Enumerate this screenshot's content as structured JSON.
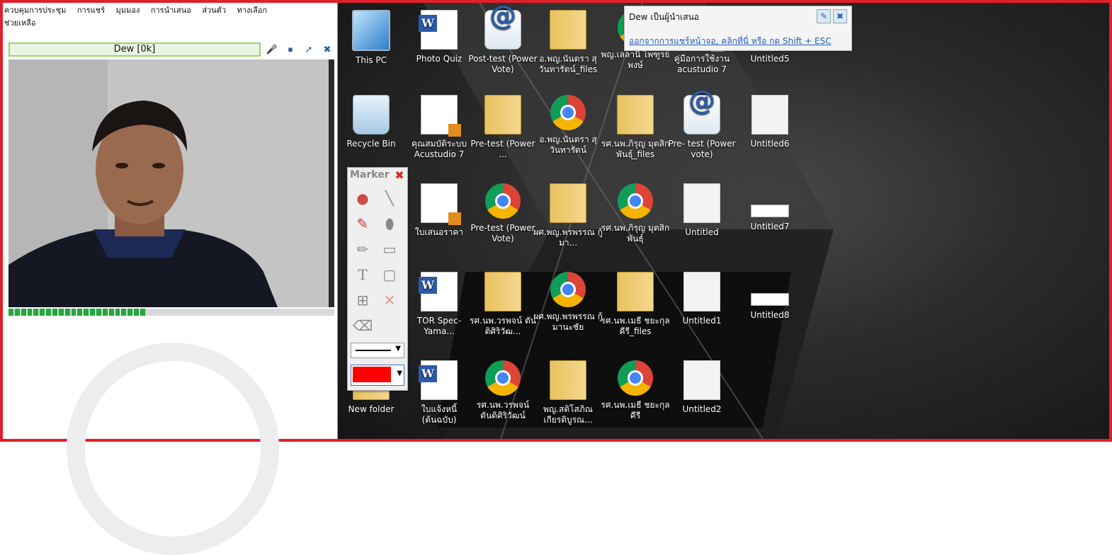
{
  "menu": {
    "items": [
      "ควบคุมการประชุม",
      "การแชร์",
      "มุมมอง",
      "การนำเสนอ",
      "ส่วนตัว",
      "ทางเลือก"
    ],
    "second_line": "ช่วยเหลือ"
  },
  "participant": {
    "name_label": "Dew [0k]",
    "level_fraction": 0.42
  },
  "presenter_panel": {
    "title": "Dew เป็นผู้นำเสนอ",
    "exit_link": "ออกจากการแชร์หน้าจอ, คลิกที่นี่ หรือ กด Shift + ESC"
  },
  "marker_palette": {
    "title": "Marker",
    "selected_color": "#ff0000"
  },
  "desktop_icons": [
    {
      "label": "This PC",
      "icon": "this-pc"
    },
    {
      "label": "Photo Quiz",
      "icon": "word-doc"
    },
    {
      "label": "Post-test (Power Vote)",
      "icon": "acustudio"
    },
    {
      "label": "อ.พญ.นันตรา สุวันทารัตน์_files",
      "icon": "folder"
    },
    {
      "label": "พญ.เลลานี ไพฑูรย์พงษ์",
      "icon": "chrome"
    },
    {
      "label": "คู่มือการใช้งาน acustudio 7",
      "icon": "pdf-doc"
    },
    {
      "label": "Untitled5",
      "icon": "screenshot"
    },
    {
      "label": "Recycle Bin",
      "icon": "recycle-bin"
    },
    {
      "label": "คุณสมบัติระบบ Acustudio 7",
      "icon": "pdf-doc"
    },
    {
      "label": "Pre-test (Power ...",
      "icon": "folder"
    },
    {
      "label": "อ.พญ.นันตรา สุวันทารัตน์",
      "icon": "chrome"
    },
    {
      "label": "รศ.นพ.ภิรุญ มุตสิกพันธุ์_files",
      "icon": "folder"
    },
    {
      "label": "Pre- test (Power vote)",
      "icon": "acustudio"
    },
    {
      "label": "Untitled6",
      "icon": "screenshot"
    },
    {
      "label": "ใบเสนอราคา",
      "icon": "pdf-doc"
    },
    {
      "label": "Pre-test (Power Vote)",
      "icon": "chrome"
    },
    {
      "label": "ผศ.พญ.พรพรรณ กู้มา...",
      "icon": "folder"
    },
    {
      "label": "รศ.นพ.ภิรุญ มุตสิกพันธุ์",
      "icon": "chrome"
    },
    {
      "label": "Untitled",
      "icon": "screenshot"
    },
    {
      "label": "Untitled7",
      "icon": "strip"
    },
    {
      "label": "TOR Spec-Yama...",
      "icon": "word-doc"
    },
    {
      "label": "รศ.นพ.วรพจน์ ตันติศิริวัฒ...",
      "icon": "folder"
    },
    {
      "label": "ผศ.พญ.พรพรรณ กู้มานะชัย",
      "icon": "chrome"
    },
    {
      "label": "รศ.นพ.เมธี ชยะกุลคีรี_files",
      "icon": "folder"
    },
    {
      "label": "Untitled1",
      "icon": "screenshot"
    },
    {
      "label": "Untitled8",
      "icon": "strip"
    },
    {
      "label": "New folder",
      "icon": "folder"
    },
    {
      "label": "ใบแจ้งหนี้ (ต้นฉบับ)",
      "icon": "word-doc"
    },
    {
      "label": "รศ.นพ.วรพจน์ ตันติศิริวัฒน์",
      "icon": "chrome"
    },
    {
      "label": "พญ.สติโสภิณ เกียรติบูรณ...",
      "icon": "folder"
    },
    {
      "label": "รศ.นพ.เมธี ชยะกุลคีรี",
      "icon": "chrome"
    },
    {
      "label": "Untitled2",
      "icon": "screenshot"
    }
  ],
  "colors": {
    "frame_border": "#e0202a",
    "level_fill": "#22a83a",
    "namebar_border": "#8fd86c",
    "link": "#1f5fc2"
  }
}
